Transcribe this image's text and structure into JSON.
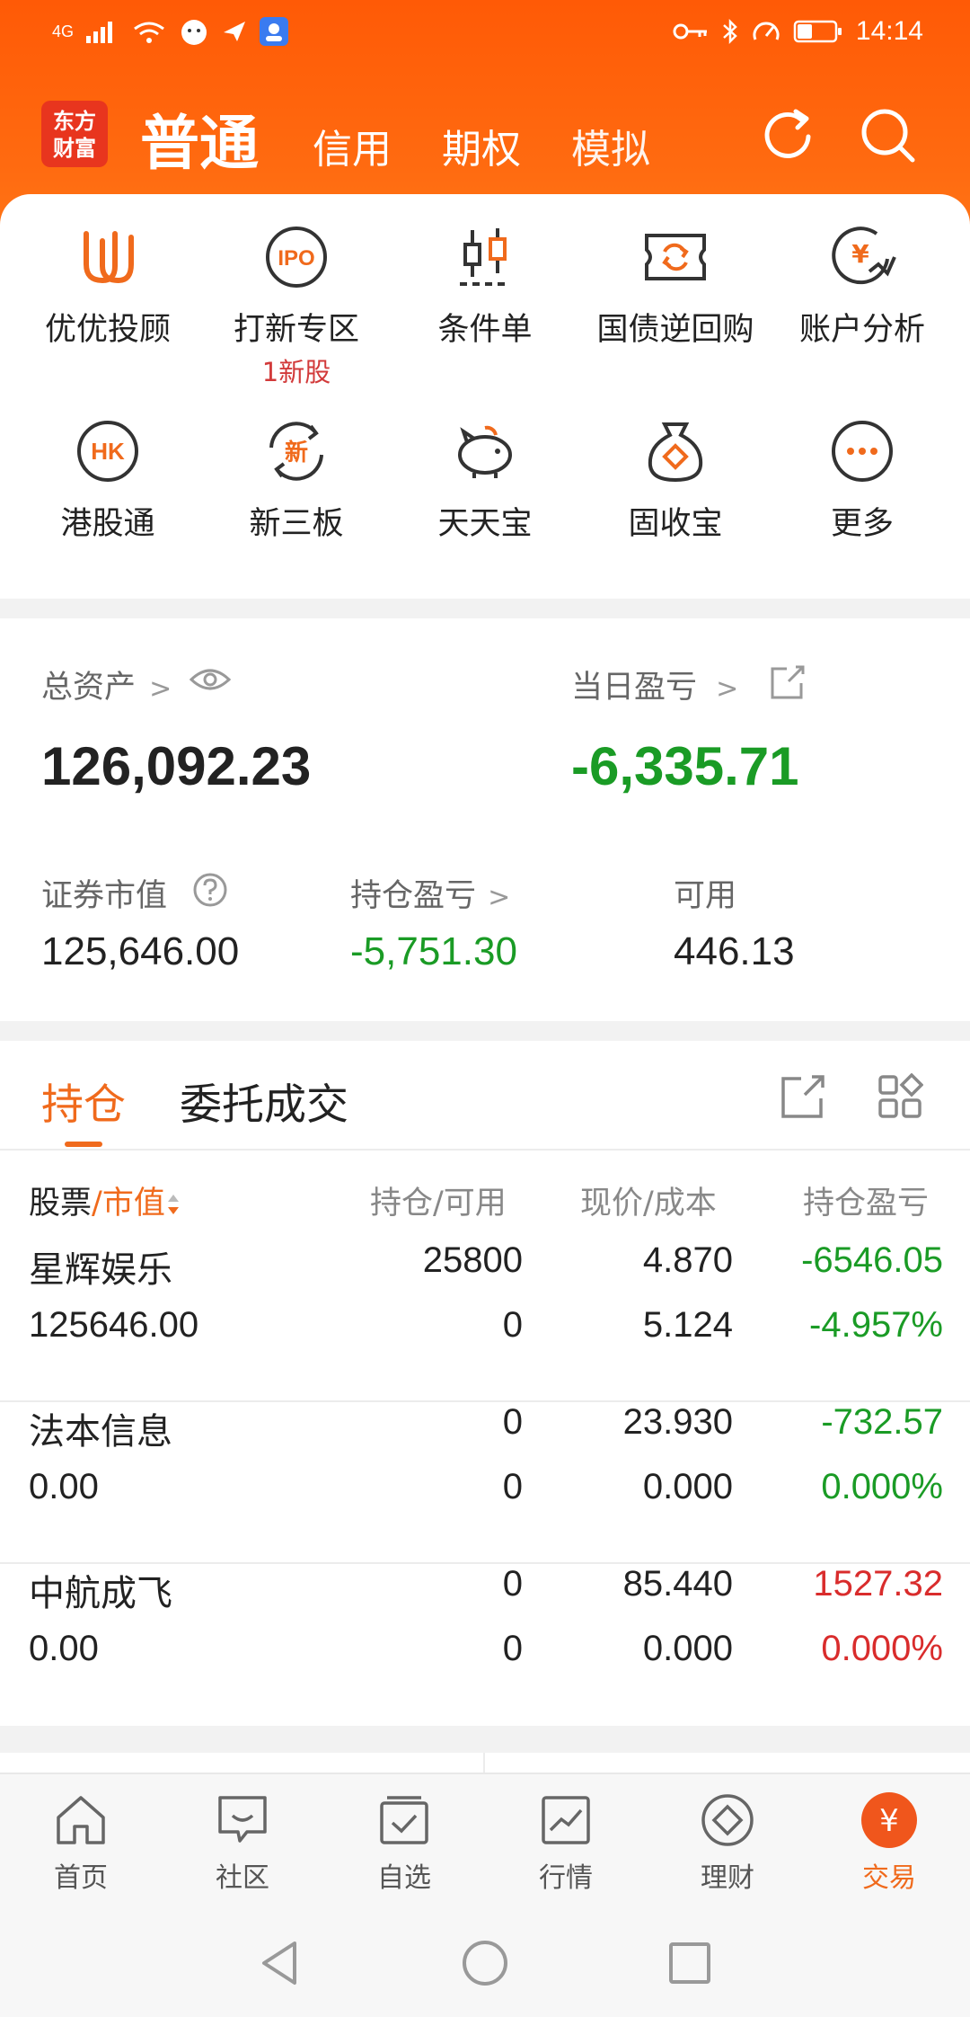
{
  "status_bar": {
    "network": "4G",
    "time": "14:14"
  },
  "nav": {
    "logo_line1": "东方",
    "logo_line2": "财富",
    "tabs": [
      {
        "label": "普通"
      },
      {
        "label": "信用"
      },
      {
        "label": "期权"
      },
      {
        "label": "模拟"
      }
    ]
  },
  "quick_menu": [
    {
      "label": "优优投顾",
      "icon": "uu-advisor-icon"
    },
    {
      "label": "打新专区",
      "icon": "ipo-icon",
      "badge": "1新股"
    },
    {
      "label": "条件单",
      "icon": "candlestick-icon"
    },
    {
      "label": "国债逆回购",
      "icon": "repo-icon"
    },
    {
      "label": "账户分析",
      "icon": "yen-chart-icon"
    },
    {
      "label": "港股通",
      "icon": "hk-icon"
    },
    {
      "label": "新三板",
      "icon": "new-board-icon"
    },
    {
      "label": "天天宝",
      "icon": "piggy-bank-icon"
    },
    {
      "label": "固收宝",
      "icon": "money-bag-icon"
    },
    {
      "label": "更多",
      "icon": "more-icon"
    }
  ],
  "assets": {
    "total_label": "总资产",
    "total_value": "126,092.23",
    "daily_pnl_label": "当日盈亏",
    "daily_pnl_value": "-6,335.71",
    "market_value_label": "证券市值",
    "market_value": "125,646.00",
    "position_pnl_label": "持仓盈亏",
    "position_pnl_value": "-5,751.30",
    "available_label": "可用",
    "available_value": "446.13"
  },
  "holdings": {
    "tabs": [
      {
        "label": "持仓"
      },
      {
        "label": "委托成交"
      }
    ],
    "col_stock": "股票",
    "col_slash": "/",
    "col_mv": "市值",
    "col_qty": "持仓/可用",
    "col_price": "现价/成本",
    "col_pnl": "持仓盈亏",
    "rows": [
      {
        "name": "星辉娱乐",
        "market_value": "125646.00",
        "qty": "25800",
        "available": "0",
        "price": "4.870",
        "cost": "5.124",
        "pnl": "-6546.05",
        "pnl_pct": "-4.957%",
        "color": "#1a9b25"
      },
      {
        "name": "法本信息",
        "market_value": "0.00",
        "qty": "0",
        "available": "0",
        "price": "23.930",
        "cost": "0.000",
        "pnl": "-732.57",
        "pnl_pct": "0.000%",
        "color": "#1a9b25"
      },
      {
        "name": "中航成飞",
        "market_value": "0.00",
        "qty": "0",
        "available": "0",
        "price": "85.440",
        "cost": "0.000",
        "pnl": "1527.32",
        "pnl_pct": "0.000%",
        "color": "#d92c2c"
      }
    ]
  },
  "bottom_nav": [
    {
      "label": "首页",
      "icon": "home-icon"
    },
    {
      "label": "社区",
      "icon": "community-icon"
    },
    {
      "label": "自选",
      "icon": "watchlist-icon"
    },
    {
      "label": "行情",
      "icon": "market-icon"
    },
    {
      "label": "理财",
      "icon": "wealth-icon"
    },
    {
      "label": "交易",
      "icon": "trade-icon"
    }
  ],
  "colors": {
    "brand_orange": "#ff6a10",
    "accent": "#f06a1c",
    "loss_green": "#1a9b25",
    "gain_red": "#d92c2c"
  }
}
